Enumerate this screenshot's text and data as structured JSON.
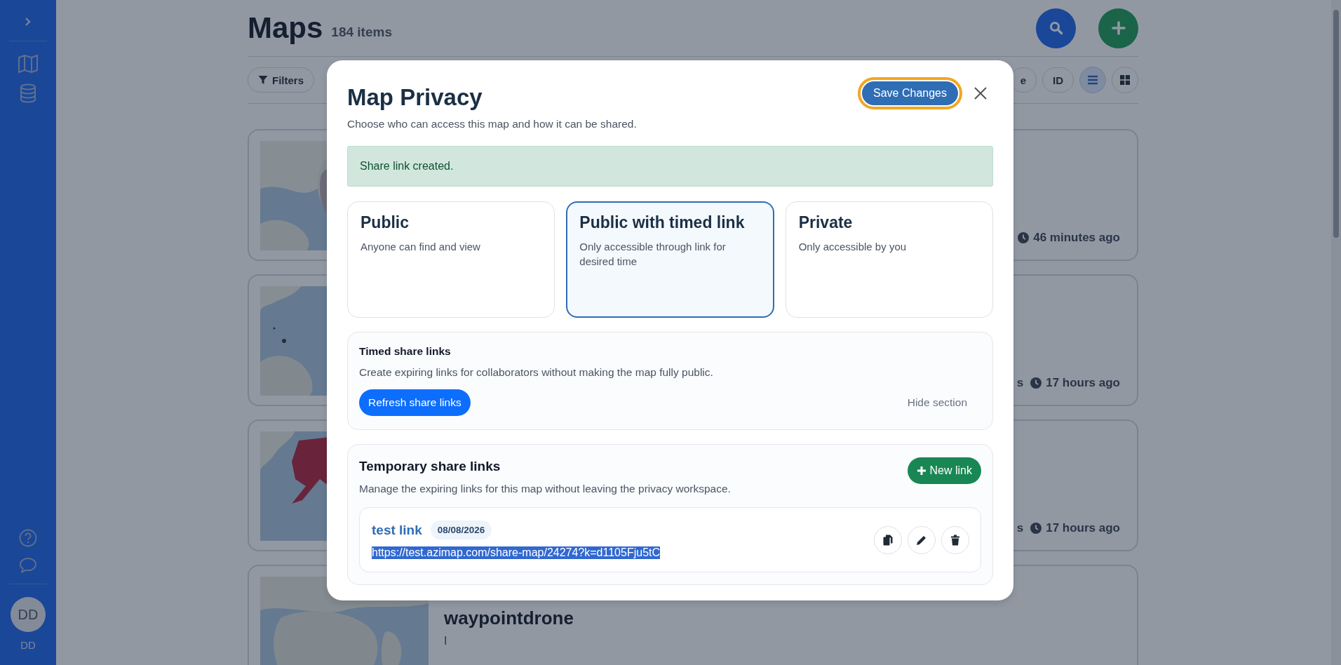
{
  "sidebar": {
    "avatar": "DD",
    "user_label": "DD"
  },
  "header": {
    "title": "Maps",
    "count": "184 items"
  },
  "toolbar": {
    "filters": "Filters",
    "sort_partial": "e",
    "id_button": "ID",
    "views": [
      {
        "kind": "list",
        "selected": true
      },
      {
        "kind": "grid",
        "selected": false
      }
    ]
  },
  "cards": [
    {
      "time": "46 minutes ago"
    },
    {
      "meta": "s",
      "time": "17 hours ago"
    },
    {
      "meta": "s",
      "time": "17 hours ago"
    },
    {
      "title": "waypointdrone",
      "subtitle": "I"
    }
  ],
  "modal": {
    "title": "Map Privacy",
    "subtitle": "Choose who can access this map and how it can be shared.",
    "save_button": "Save Changes",
    "alert": "Share link created.",
    "options": [
      {
        "title": "Public",
        "description": "Anyone can find and view",
        "selected": false
      },
      {
        "title": "Public with timed link",
        "description": "Only accessible through link for desired time",
        "selected": true
      },
      {
        "title": "Private",
        "description": "Only accessible by you",
        "selected": false
      }
    ],
    "timed": {
      "title": "Timed share links",
      "description": "Create expiring links for collaborators without making the map fully public.",
      "refresh_button": "Refresh share links",
      "hide_button": "Hide section"
    },
    "temporary": {
      "title": "Temporary share links",
      "description": "Manage the expiring links for this map without leaving the privacy workspace.",
      "new_button": "New link",
      "links": [
        {
          "name": "test link",
          "date": "08/08/2026",
          "url": "https://test.azimap.com/share-map/24274?k=d1105Fju5tC",
          "url_highlighted": true
        }
      ]
    }
  }
}
